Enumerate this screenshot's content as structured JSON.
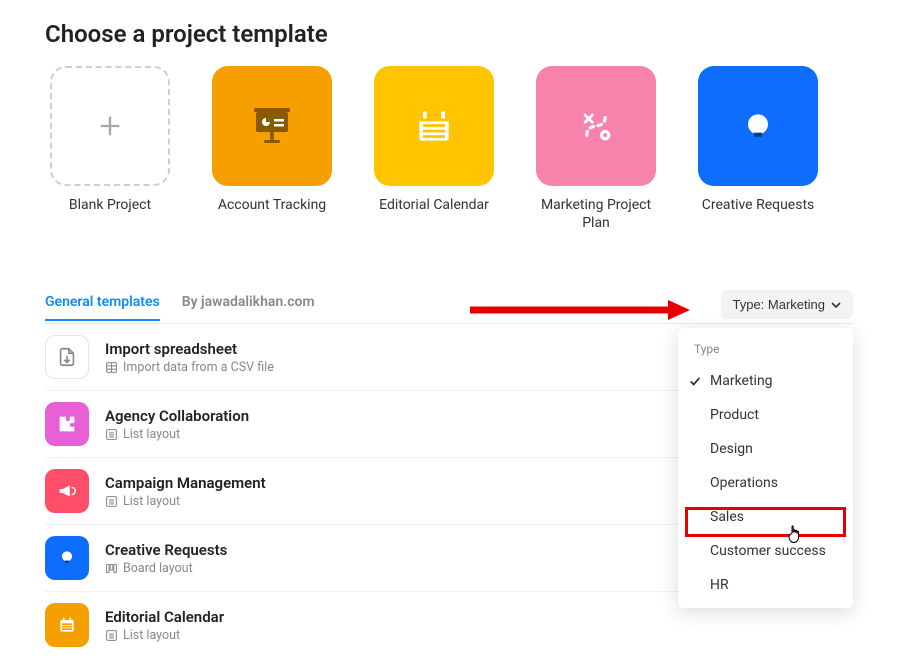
{
  "page_title": "Choose a project template",
  "cards": [
    {
      "label": "Blank Project"
    },
    {
      "label": "Account Tracking"
    },
    {
      "label": "Editorial Calendar"
    },
    {
      "label": "Marketing Project Plan"
    },
    {
      "label": "Creative Requests"
    }
  ],
  "tabs": {
    "general": "General templates",
    "by": "By jawadalikhan.com"
  },
  "filter": {
    "label": "Type: Marketing"
  },
  "dropdown": {
    "header": "Type",
    "items": [
      {
        "label": "Marketing",
        "selected": true
      },
      {
        "label": "Product"
      },
      {
        "label": "Design"
      },
      {
        "label": "Operations"
      },
      {
        "label": "Sales"
      },
      {
        "label": "Customer success"
      },
      {
        "label": "HR"
      }
    ]
  },
  "list": [
    {
      "title": "Import spreadsheet",
      "sub": "Import data from a CSV file",
      "subicon": "spreadsheet"
    },
    {
      "title": "Agency Collaboration",
      "sub": "List layout",
      "subicon": "list"
    },
    {
      "title": "Campaign Management",
      "sub": "List layout",
      "subicon": "list"
    },
    {
      "title": "Creative Requests",
      "sub": "Board layout",
      "subicon": "board"
    },
    {
      "title": "Editorial Calendar",
      "sub": "List layout",
      "subicon": "list"
    }
  ]
}
